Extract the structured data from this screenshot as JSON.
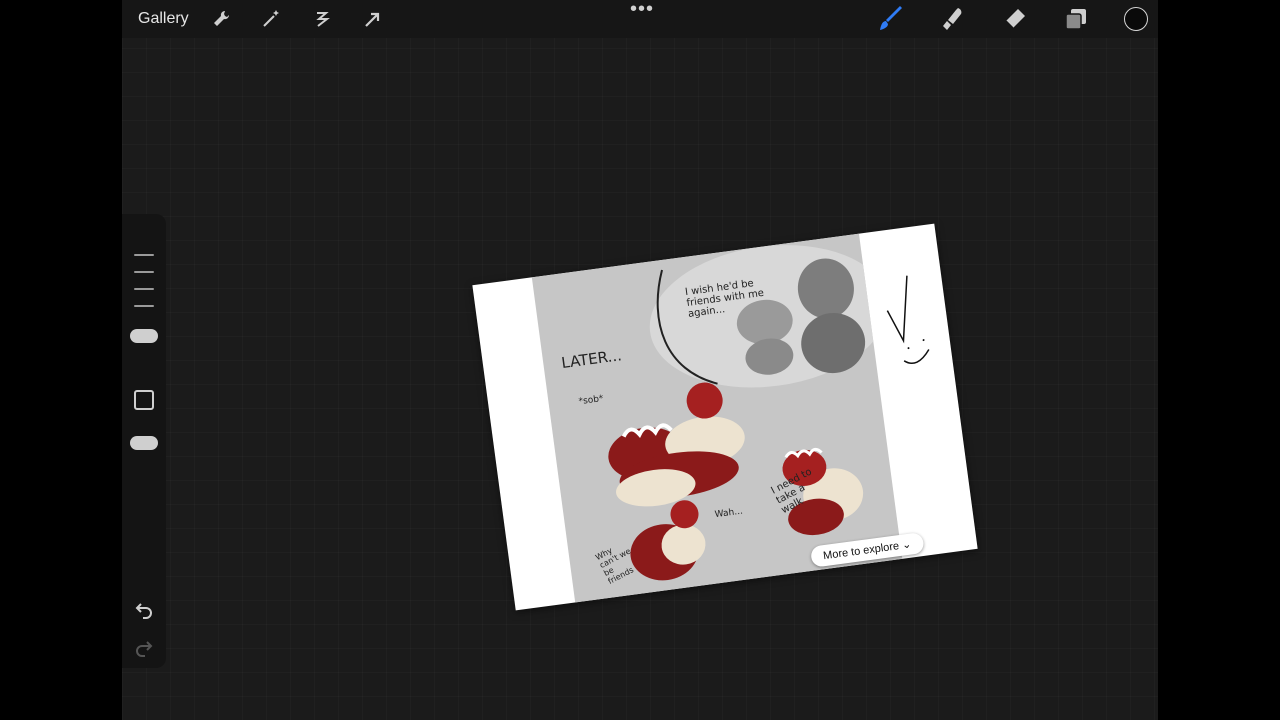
{
  "topbar": {
    "gallery_label": "Gallery",
    "more_icon": "more-dots-icon",
    "left_tools": [
      "wrench-icon",
      "magic-wand-icon",
      "selection-icon",
      "move-arrow-icon"
    ],
    "right_tools": [
      "brush-icon",
      "smudge-icon",
      "eraser-icon",
      "layers-icon",
      "color-swatch-icon"
    ],
    "accent_color": "#2f7cf6",
    "current_color": "#0a0a0a"
  },
  "sidebar": {
    "tools": [
      "brush-size-slider",
      "modify-button",
      "opacity-slider",
      "undo-icon",
      "redo-icon"
    ]
  },
  "canvas": {
    "artwork_texts": {
      "speech": "I wish he'd be friends with me again...",
      "later": "LATER...",
      "sob": "*sob*",
      "walk": "I need to take a walk",
      "why": "Why can't we be friends",
      "wah": "Wah..."
    },
    "more_to_explore": "More to explore"
  }
}
